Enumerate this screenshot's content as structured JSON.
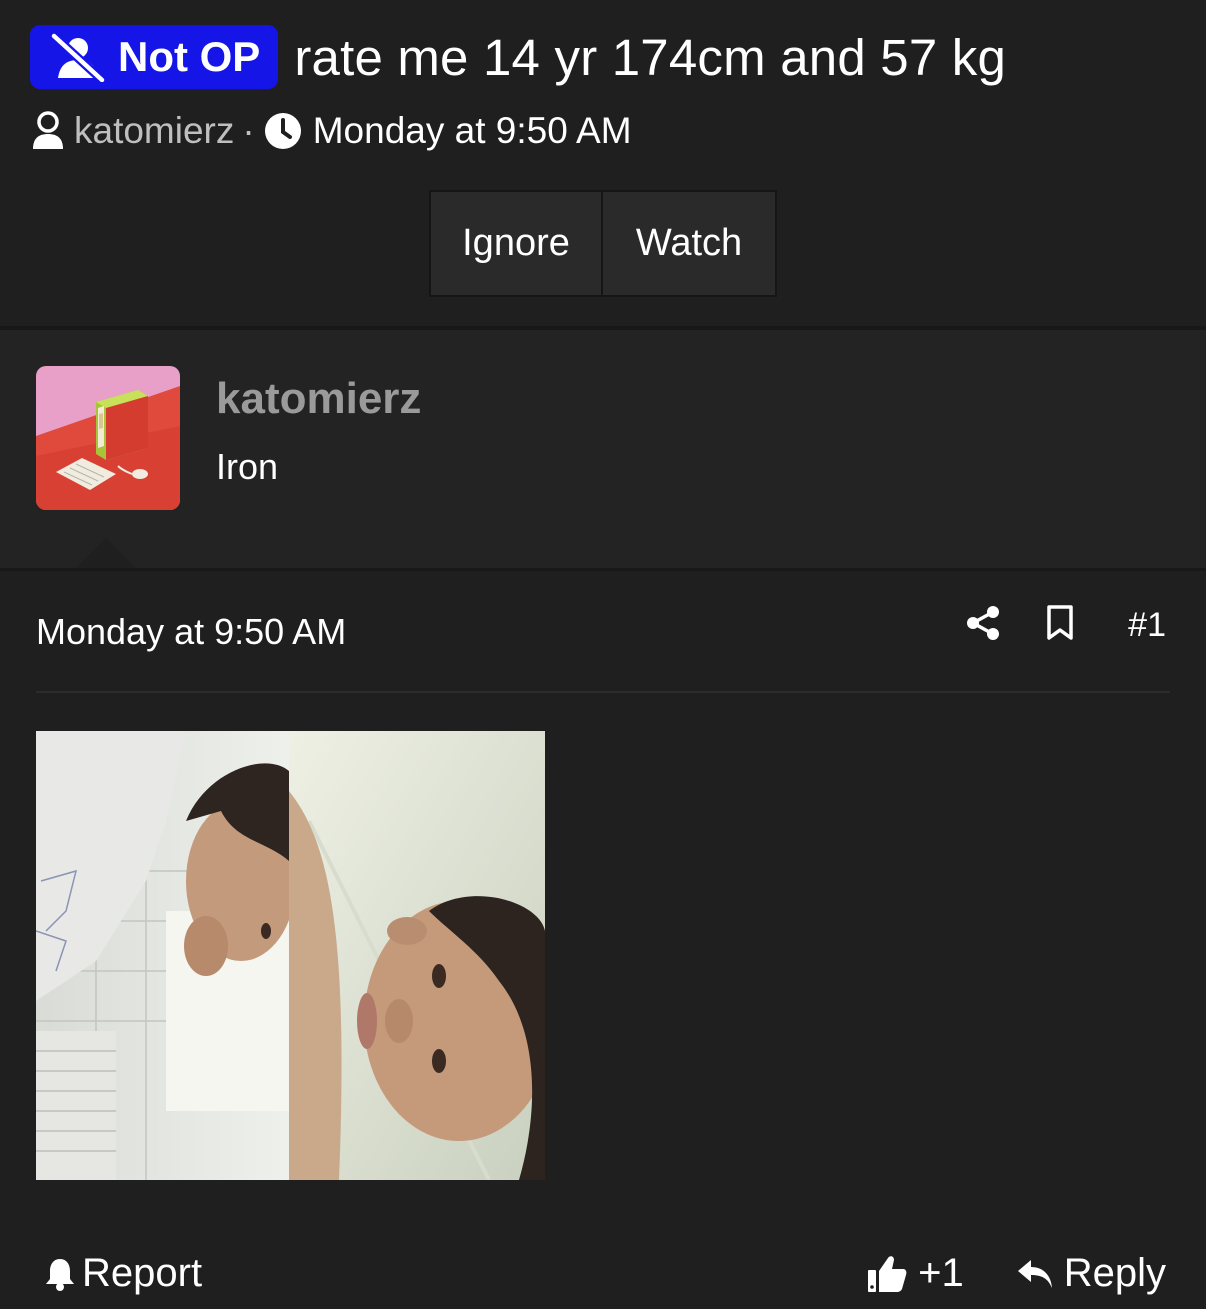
{
  "thread": {
    "badge_label": "Not OP",
    "title": "rate me 14 yr 174cm and 57 kg",
    "author": "katomierz",
    "separator": "·",
    "time": "Monday at 9:50 AM",
    "badge_color": "#1515e8"
  },
  "thread_actions": {
    "ignore_label": "Ignore",
    "watch_label": "Watch"
  },
  "post": {
    "author_name": "katomierz",
    "author_rank": "Iron",
    "date": "Monday at 9:50 AM",
    "post_number": "#1",
    "like_count": "+1",
    "report_label": "Report",
    "reply_label": "Reply"
  },
  "icons": {
    "badge": "person-slash-icon",
    "author": "user-icon",
    "time": "clock-icon",
    "share": "share-icon",
    "bookmark": "bookmark-icon",
    "report": "bell-icon",
    "like": "thumbs-up-icon",
    "reply": "reply-arrow-icon"
  }
}
